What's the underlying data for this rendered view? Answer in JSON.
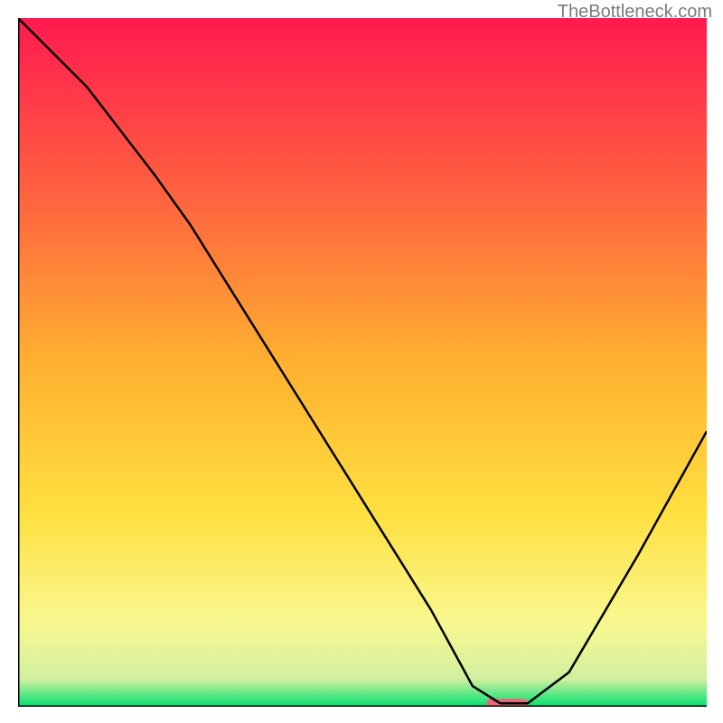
{
  "watermark": "TheBottleneck.com",
  "chart_data": {
    "type": "line",
    "title": "",
    "xlabel": "",
    "ylabel": "",
    "xlim": [
      0,
      100
    ],
    "ylim": [
      0,
      100
    ],
    "grid": false,
    "legend": false,
    "annotations": [
      {
        "text": "TheBottleneck.com",
        "position": "top-right"
      }
    ],
    "background": {
      "type": "gradient",
      "direction": "vertical",
      "stops": [
        {
          "pos": 0.0,
          "color": "#ff1a4f"
        },
        {
          "pos": 0.25,
          "color": "#ff6040"
        },
        {
          "pos": 0.5,
          "color": "#ffb030"
        },
        {
          "pos": 0.72,
          "color": "#ffe040"
        },
        {
          "pos": 0.88,
          "color": "#f8f890"
        },
        {
          "pos": 0.96,
          "color": "#d0f0a0"
        },
        {
          "pos": 1.0,
          "color": "#00e070"
        }
      ]
    },
    "series": [
      {
        "name": "curve",
        "color": "#000000",
        "x": [
          0,
          10,
          20,
          25,
          30,
          40,
          50,
          60,
          66,
          70,
          74,
          80,
          90,
          100
        ],
        "y": [
          100,
          90,
          77,
          70,
          62,
          46,
          30,
          14,
          3,
          0.5,
          0.5,
          5,
          22,
          40
        ]
      }
    ],
    "marker": {
      "x_range": [
        68,
        74
      ],
      "y": 0.5,
      "color": "#e9697a"
    },
    "axes": {
      "left": true,
      "bottom": true,
      "color": "#000000",
      "width": 3
    }
  }
}
